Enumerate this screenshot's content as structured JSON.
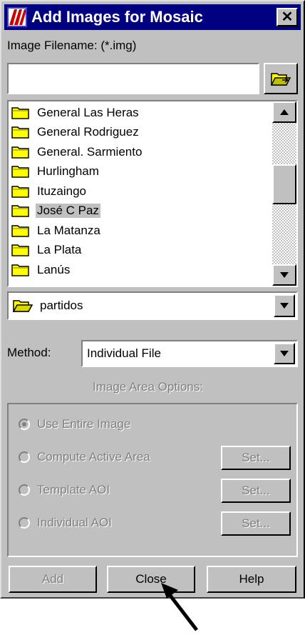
{
  "window": {
    "title": "Add Images for Mosaic",
    "close_glyph": "✕"
  },
  "file": {
    "label": "Image Filename: (*.img)",
    "value": ""
  },
  "folder_list": {
    "items": [
      "General Las Heras",
      "General Rodriguez",
      "General. Sarmiento",
      "Hurlingham",
      "Ituzaingo",
      "José C Paz",
      "La Matanza",
      "La Plata",
      "Lanús"
    ],
    "selected_index": 5
  },
  "directory": {
    "value": "partidos"
  },
  "method": {
    "label": "Method:",
    "value": "Individual File"
  },
  "area_options": {
    "label": "Image Area Options:",
    "radios": [
      {
        "label": "Use Entire Image",
        "selected": true
      },
      {
        "label": "Compute Active Area",
        "selected": false
      },
      {
        "label": "Template AOI",
        "selected": false
      },
      {
        "label": "Individual AOI",
        "selected": false
      }
    ],
    "set_label": "Set..."
  },
  "buttons": {
    "add": "Add",
    "close": "Close",
    "help": "Help"
  },
  "colors": {
    "titlebar": "#000080",
    "face": "#c0c0c0",
    "disabled_text": "#808080",
    "folder": "#ffff00"
  },
  "icons": {
    "title": "mosaic-app-icon",
    "browse": "open-folder-icon",
    "folder": "folder-icon",
    "scroll_up": "scroll-up-arrow-icon",
    "scroll_down": "scroll-down-arrow-icon",
    "dropdown": "dropdown-arrow-icon",
    "annotation": "pointer-arrow-icon"
  }
}
